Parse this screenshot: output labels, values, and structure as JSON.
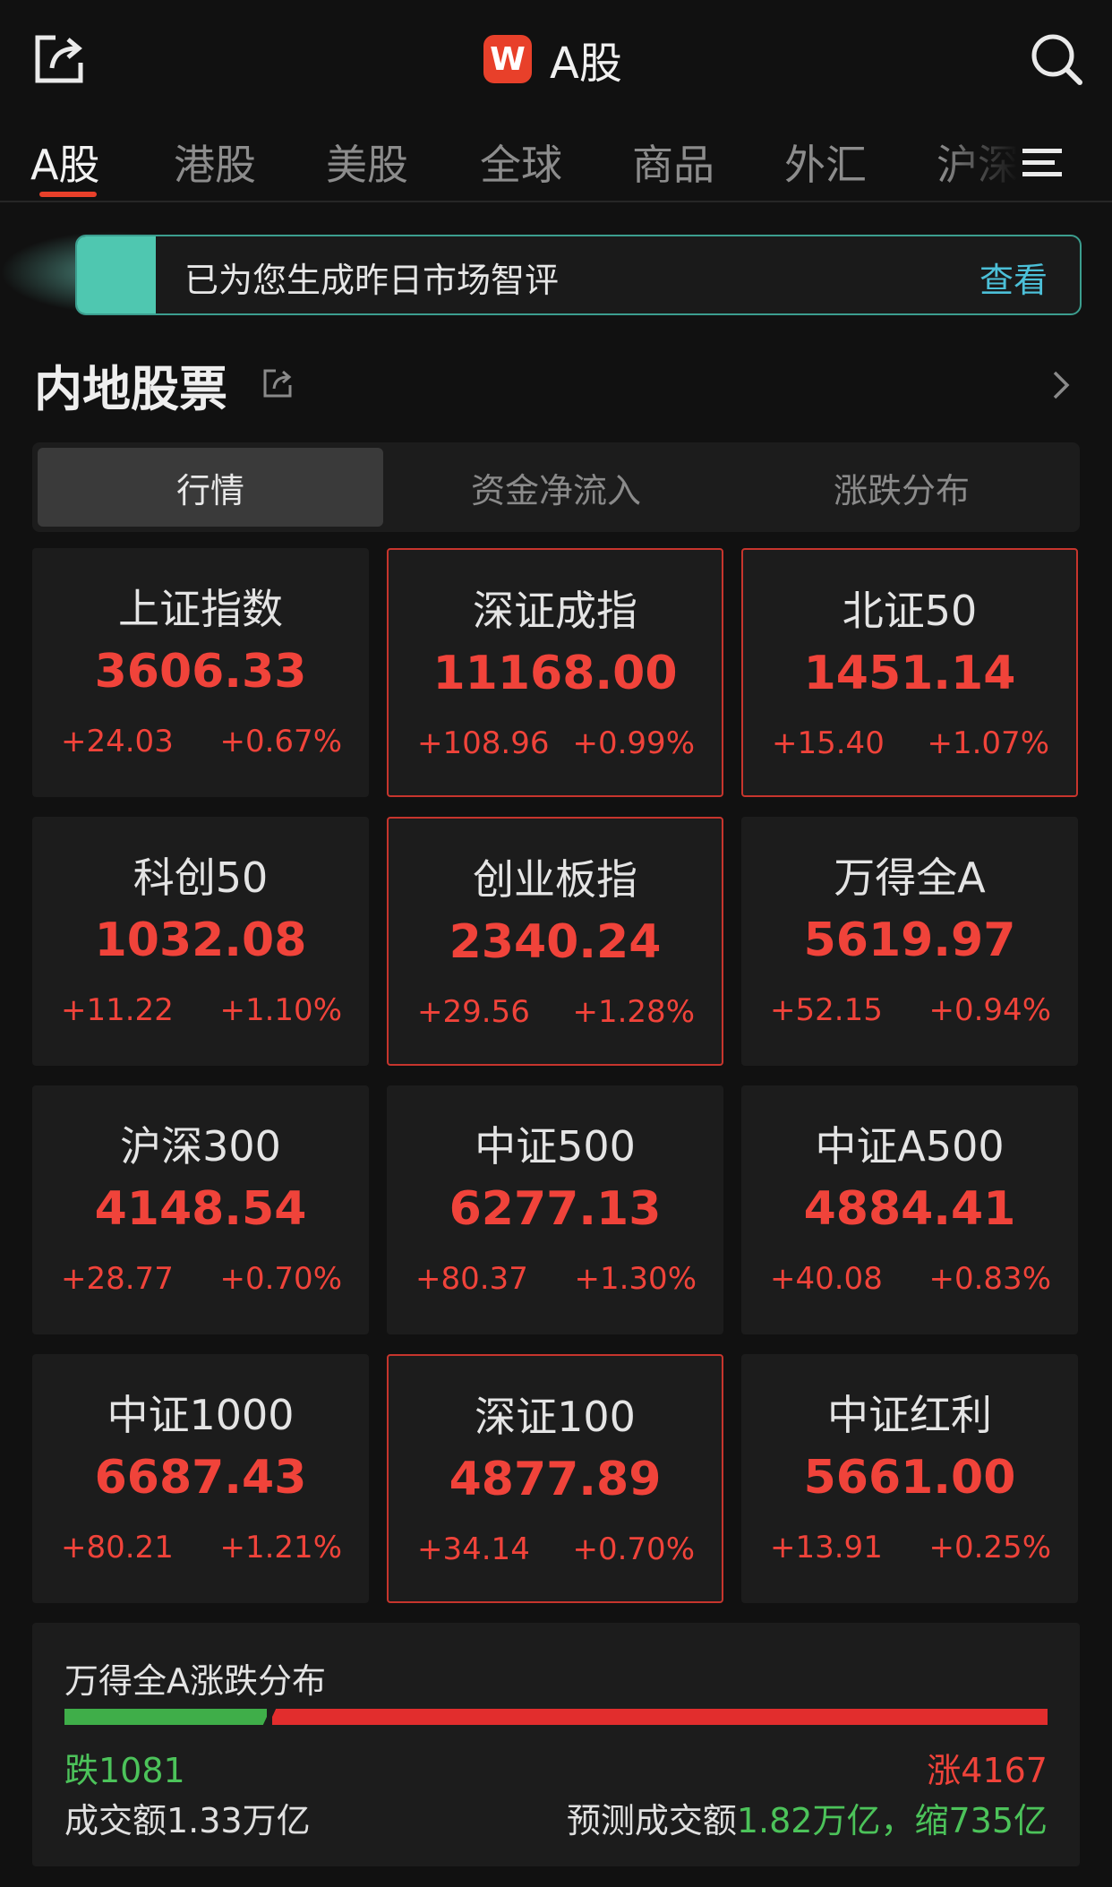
{
  "header": {
    "title": "A股",
    "logo_letter": "W",
    "brand_color": "#e8402a"
  },
  "tabs": [
    "A股",
    "港股",
    "美股",
    "全球",
    "商品",
    "外汇",
    "沪深"
  ],
  "banner": {
    "text": "已为您生成昨日市场智评",
    "action": "查看"
  },
  "section": {
    "title": "内地股票"
  },
  "segments": [
    "行情",
    "资金净流入",
    "涨跌分布"
  ],
  "indices": [
    {
      "name": "上证指数",
      "price": "3606.33",
      "change": "+24.03",
      "pct": "+0.67%",
      "highlighted": false
    },
    {
      "name": "深证成指",
      "price": "11168.00",
      "change": "+108.96",
      "pct": "+0.99%",
      "highlighted": true
    },
    {
      "name": "北证50",
      "price": "1451.14",
      "change": "+15.40",
      "pct": "+1.07%",
      "highlighted": true
    },
    {
      "name": "科创50",
      "price": "1032.08",
      "change": "+11.22",
      "pct": "+1.10%",
      "highlighted": false
    },
    {
      "name": "创业板指",
      "price": "2340.24",
      "change": "+29.56",
      "pct": "+1.28%",
      "highlighted": true
    },
    {
      "name": "万得全A",
      "price": "5619.97",
      "change": "+52.15",
      "pct": "+0.94%",
      "highlighted": false
    },
    {
      "name": "沪深300",
      "price": "4148.54",
      "change": "+28.77",
      "pct": "+0.70%",
      "highlighted": false
    },
    {
      "name": "中证500",
      "price": "6277.13",
      "change": "+80.37",
      "pct": "+1.30%",
      "highlighted": false
    },
    {
      "name": "中证A500",
      "price": "4884.41",
      "change": "+40.08",
      "pct": "+0.83%",
      "highlighted": false
    },
    {
      "name": "中证1000",
      "price": "6687.43",
      "change": "+80.21",
      "pct": "+1.21%",
      "highlighted": false
    },
    {
      "name": "深证100",
      "price": "4877.89",
      "change": "+34.14",
      "pct": "+0.70%",
      "highlighted": true
    },
    {
      "name": "中证红利",
      "price": "5661.00",
      "change": "+13.91",
      "pct": "+0.25%",
      "highlighted": false
    }
  ],
  "distribution": {
    "title": "万得全A涨跌分布",
    "fall_label": "跌1081",
    "rise_label": "涨4167",
    "fall_count": 1081,
    "rise_count": 4167,
    "turnover": "成交额1.33万亿",
    "forecast_label": "预测成交额",
    "forecast_value": "1.82万亿，缩735亿"
  }
}
